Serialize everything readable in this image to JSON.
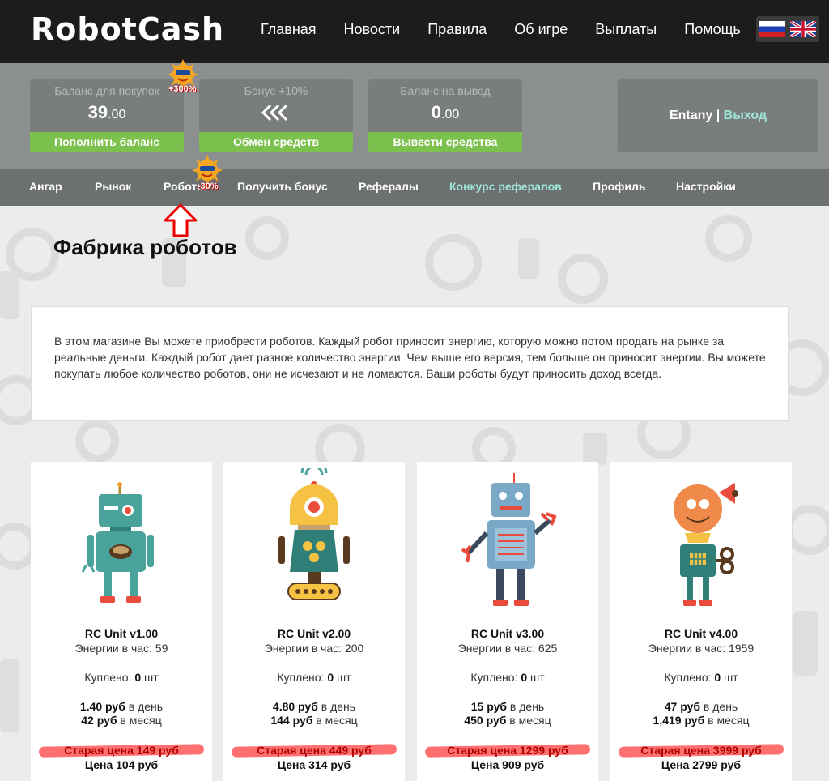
{
  "header": {
    "logo": "RobotCash",
    "nav": [
      "Главная",
      "Новости",
      "Правила",
      "Об игре",
      "Выплаты",
      "Помощь"
    ],
    "languages": [
      "russian-flag-icon",
      "uk-flag-icon"
    ]
  },
  "balances": {
    "purchase": {
      "title": "Баланс для покупок",
      "value_int": "39",
      "value_dec": ".00",
      "action": "Пополнить баланс"
    },
    "bonus": {
      "title": "Бонус +10%",
      "action": "Обмен средств"
    },
    "withdraw": {
      "title": "Баланс на вывод",
      "value_int": "0",
      "value_dec": ".00",
      "action": "Вывести средства"
    },
    "promo_badge": "+300%"
  },
  "user": {
    "name": "Entany",
    "separator": " | ",
    "logout": "Выход"
  },
  "subnav": {
    "items": [
      "Ангар",
      "Рынок",
      "Роботы",
      "Получить бонус",
      "Рефералы",
      "Конкурс рефералов",
      "Профиль",
      "Настройки"
    ],
    "promo_badge": "-30%"
  },
  "colors": {
    "accent_green": "#7cc04d",
    "accent_teal": "#9ee6d4",
    "strike_red": "#ff4040"
  },
  "page": {
    "title": "Фабрика роботов",
    "intro": "В этом магазине Вы можете приобрести роботов. Каждый робот приносит энергию, которую можно потом продать на рынке за реальные деньги. Каждый робот дает разное количество энергии. Чем выше его версия, тем больше он приносит энергии. Вы можете покупать любое количество роботов, они не исчезают и не ломаются. Ваши роботы будут приносить доход всегда."
  },
  "products": [
    {
      "name": "RC Unit v1.00",
      "energy": "Энергии в час: 59",
      "bought_label": "Куплено: ",
      "bought_qty": "0",
      "bought_unit": " шт",
      "day_value": "1.40 руб",
      "day_suffix": " в день",
      "month_value": "42 руб",
      "month_suffix": " в месяц",
      "old_price": "Старая цена 149 руб",
      "price": "Цена 104 руб"
    },
    {
      "name": "RC Unit v2.00",
      "energy": "Энергии в час: 200",
      "bought_label": "Куплено: ",
      "bought_qty": "0",
      "bought_unit": " шт",
      "day_value": "4.80 руб",
      "day_suffix": " в день",
      "month_value": "144 руб",
      "month_suffix": " в месяц",
      "old_price": "Старая цена 449 руб",
      "price": "Цена 314 руб"
    },
    {
      "name": "RC Unit v3.00",
      "energy": "Энергии в час: 625",
      "bought_label": "Куплено: ",
      "bought_qty": "0",
      "bought_unit": " шт",
      "day_value": "15 руб",
      "day_suffix": " в день",
      "month_value": "450 руб",
      "month_suffix": " в месяц",
      "old_price": "Старая цена 1299 руб",
      "price": "Цена 909 руб"
    },
    {
      "name": "RC Unit v4.00",
      "energy": "Энергии в час: 1959",
      "bought_label": "Куплено: ",
      "bought_qty": "0",
      "bought_unit": " шт",
      "day_value": "47 руб",
      "day_suffix": " в день",
      "month_value": "1,419 руб",
      "month_suffix": " в месяц",
      "old_price": "Старая цена 3999 руб",
      "price": "Цена 2799 руб"
    }
  ]
}
